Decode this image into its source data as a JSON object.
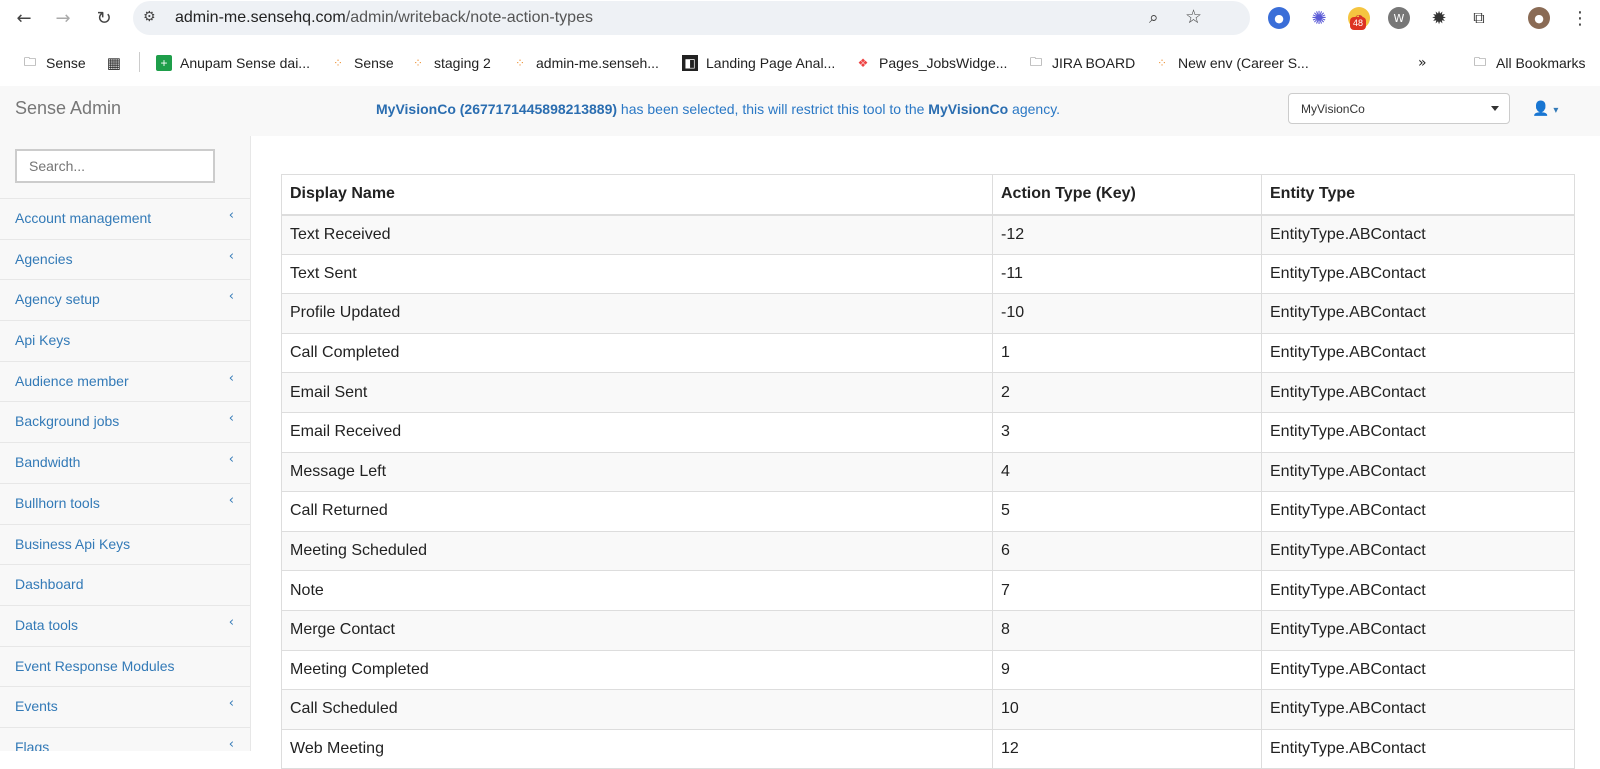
{
  "browser": {
    "url_host": "admin-me.sensehq.com",
    "url_path": "/admin/writeback/note-action-types",
    "extension_badge": "48",
    "bookmarks": [
      {
        "label": "Sense",
        "icon": "folder-icon"
      },
      {
        "label": "",
        "icon": "apps-grid-icon"
      },
      {
        "label": "Anupam Sense dai...",
        "icon": "sheets-icon"
      },
      {
        "label": "Sense",
        "icon": "dots-icon"
      },
      {
        "label": "staging 2",
        "icon": "dots-icon"
      },
      {
        "label": "admin-me.senseh...",
        "icon": "dots-icon"
      },
      {
        "label": "Landing Page Anal...",
        "icon": "page-icon"
      },
      {
        "label": "Pages_JobsWidge...",
        "icon": "figma-icon"
      },
      {
        "label": "JIRA BOARD",
        "icon": "folder-icon"
      },
      {
        "label": "New env (Career S...",
        "icon": "dots-icon"
      }
    ],
    "all_bookmarks": "All Bookmarks"
  },
  "header": {
    "brand": "Sense Admin",
    "notice_agency": "MyVisionCo (2677171445898213889)",
    "notice_mid": " has been selected, this will restrict this tool to the ",
    "notice_agency_short": "MyVisionCo",
    "notice_end": " agency.",
    "agency_selected": "MyVisionCo"
  },
  "sidebar": {
    "search_placeholder": "Search...",
    "items": [
      {
        "label": "Account management",
        "has_children": true
      },
      {
        "label": "Agencies",
        "has_children": true
      },
      {
        "label": "Agency setup",
        "has_children": true
      },
      {
        "label": "Api Keys",
        "has_children": false
      },
      {
        "label": "Audience member",
        "has_children": true
      },
      {
        "label": "Background jobs",
        "has_children": true
      },
      {
        "label": "Bandwidth",
        "has_children": true
      },
      {
        "label": "Bullhorn tools",
        "has_children": true
      },
      {
        "label": "Business Api Keys",
        "has_children": false
      },
      {
        "label": "Dashboard",
        "has_children": false
      },
      {
        "label": "Data tools",
        "has_children": true
      },
      {
        "label": "Event Response Modules",
        "has_children": false
      },
      {
        "label": "Events",
        "has_children": true
      },
      {
        "label": "Flags",
        "has_children": true
      }
    ]
  },
  "table": {
    "headers": [
      "Display Name",
      "Action Type (Key)",
      "Entity Type"
    ],
    "rows": [
      [
        "Text Received",
        "-12",
        "EntityType.ABContact"
      ],
      [
        "Text Sent",
        "-11",
        "EntityType.ABContact"
      ],
      [
        "Profile Updated",
        "-10",
        "EntityType.ABContact"
      ],
      [
        "Call Completed",
        "1",
        "EntityType.ABContact"
      ],
      [
        "Email Sent",
        "2",
        "EntityType.ABContact"
      ],
      [
        "Email Received",
        "3",
        "EntityType.ABContact"
      ],
      [
        "Message Left",
        "4",
        "EntityType.ABContact"
      ],
      [
        "Call Returned",
        "5",
        "EntityType.ABContact"
      ],
      [
        "Meeting Scheduled",
        "6",
        "EntityType.ABContact"
      ],
      [
        "Note",
        "7",
        "EntityType.ABContact"
      ],
      [
        "Merge Contact",
        "8",
        "EntityType.ABContact"
      ],
      [
        "Meeting Completed",
        "9",
        "EntityType.ABContact"
      ],
      [
        "Call Scheduled",
        "10",
        "EntityType.ABContact"
      ],
      [
        "Web Meeting",
        "12",
        "EntityType.ABContact"
      ]
    ]
  }
}
